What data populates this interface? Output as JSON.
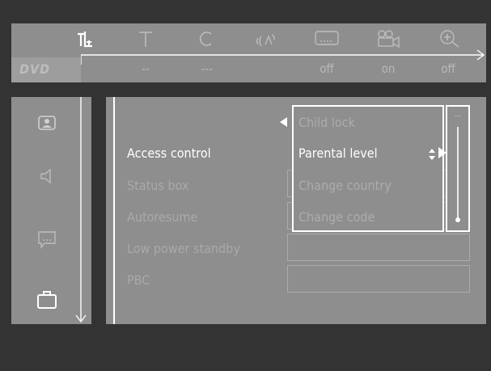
{
  "top_bar": {
    "logo": "DVD",
    "icons": [
      {
        "name": "tools-icon",
        "value": ""
      },
      {
        "name": "title-icon",
        "value": "--"
      },
      {
        "name": "chapter-icon",
        "value": "---"
      },
      {
        "name": "audio-icon",
        "value": ""
      },
      {
        "name": "subtitle-icon",
        "value": "off"
      },
      {
        "name": "angle-icon",
        "value": "on"
      },
      {
        "name": "zoom-icon",
        "value": "off"
      }
    ],
    "title_value": "--",
    "chapter_value": "---",
    "subtitle_value": "off",
    "angle_value": "on",
    "zoom_value": "off"
  },
  "side_icons": [
    "picture-icon",
    "sound-icon",
    "language-icon",
    "features-icon"
  ],
  "menu": {
    "items": [
      {
        "label": "Access control",
        "active": true
      },
      {
        "label": "Status box",
        "active": false
      },
      {
        "label": "Autoresume",
        "active": false
      },
      {
        "label": "Low power standby",
        "active": false
      },
      {
        "label": "PBC",
        "active": false
      }
    ]
  },
  "submenu": {
    "items": [
      {
        "label": "Child lock",
        "selected": false
      },
      {
        "label": "Parental level",
        "selected": true
      },
      {
        "label": "Change country",
        "selected": false
      },
      {
        "label": "Change code",
        "selected": false
      }
    ],
    "level_value": "--"
  },
  "colors": {
    "background": "#333333",
    "panel": "#8e8e8e",
    "highlight": "#ffffff",
    "dim_text": "#a9a9a9"
  }
}
